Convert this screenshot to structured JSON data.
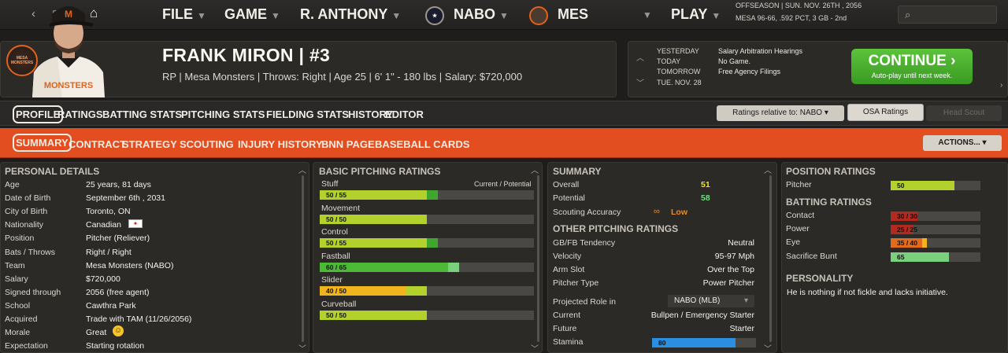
{
  "nav": {
    "back": "‹",
    "forward": "›",
    "menu": "▯",
    "home": "⌂"
  },
  "menus": {
    "file": "FILE",
    "game": "GAME",
    "manager": "R. ANTHONY",
    "league": "NABO",
    "team": "MES",
    "play": "PLAY"
  },
  "top_info": {
    "phase": "OFFSEASON",
    "date": "SUN. NOV. 26TH , 2056",
    "team": "MESA",
    "record": "96-66, .592 PCT, 3 GB - 2nd"
  },
  "search": {
    "icon": "⌕"
  },
  "player": {
    "name": "FRANK MIRON  |  #3",
    "info": "RP | Mesa Monsters  |  Throws: Right  |  Age 25  |  6' 1\" - 180 lbs  |  Salary: $720,000",
    "logo": "MESA MONSTERS"
  },
  "schedule": {
    "rows": [
      {
        "label": "YESTERDAY",
        "value": "Salary Arbitration Hearings"
      },
      {
        "label": "TODAY",
        "value": "No Game."
      },
      {
        "label": "TOMORROW",
        "value": "Free Agency Filings"
      },
      {
        "label": "TUE. NOV. 28",
        "value": ""
      }
    ],
    "continue_label": "CONTINUE  ›",
    "continue_sub": "Auto-play until next week."
  },
  "tabs1": [
    "PROFILE",
    "RATINGS",
    "BATTING STATS",
    "PITCHING STATS",
    "FIELDING STATS",
    "HISTORY",
    "EDITOR"
  ],
  "tabs1_selected": "PROFILE",
  "ratings_relative": "Ratings relative to: NABO",
  "osa_ratings": "OSA Ratings",
  "head_scout": "Head Scout",
  "tabs2": [
    "SUMMARY",
    "CONTRACT",
    "STRATEGY",
    "SCOUTING",
    "INJURY HISTORY",
    "BNN PAGE",
    "BASEBALL CARDS"
  ],
  "tabs2_selected": "SUMMARY",
  "actions": "ACTIONS...",
  "personal": {
    "title": "PERSONAL DETAILS",
    "rows": [
      {
        "label": "Age",
        "value": "25 years, 81 days"
      },
      {
        "label": "Date of Birth",
        "value": "September 6th , 2031"
      },
      {
        "label": "City of Birth",
        "value": "Toronto, ON"
      },
      {
        "label": "Nationality",
        "value": "Canadian"
      },
      {
        "label": "Position",
        "value": "Pitcher (Reliever)"
      },
      {
        "label": "Bats / Throws",
        "value": "Right / Right"
      },
      {
        "label": "Team",
        "value": "Mesa Monsters (NABO)"
      },
      {
        "label": "Salary",
        "value": "$720,000"
      },
      {
        "label": "Signed through",
        "value": "2056 (free agent)"
      },
      {
        "label": "School",
        "value": "Cawthra Park"
      },
      {
        "label": "Acquired",
        "value": "Trade with TAM (11/26/2056)"
      },
      {
        "label": "Morale",
        "value": "Great"
      },
      {
        "label": "Expectation",
        "value": "Starting rotation"
      }
    ]
  },
  "pitching": {
    "title": "BASIC PITCHING RATINGS",
    "col_header": "Current / Potential",
    "rows": [
      {
        "label": "Stuff",
        "text": "50 / 55",
        "current": 50,
        "potential": 55,
        "color": "#b3d12c",
        "pcolor": "#3fa62e"
      },
      {
        "label": "Movement",
        "text": "50 / 50",
        "current": 50,
        "potential": 50,
        "color": "#b3d12c",
        "pcolor": "#3fa62e"
      },
      {
        "label": "Control",
        "text": "50 / 55",
        "current": 50,
        "potential": 55,
        "color": "#b3d12c",
        "pcolor": "#3fa62e"
      },
      {
        "label": "Fastball",
        "text": "60 / 65",
        "current": 60,
        "potential": 65,
        "color": "#4cba36",
        "pcolor": "#7bd07d"
      },
      {
        "label": "Slider",
        "text": "40 / 50",
        "current": 40,
        "potential": 50,
        "color": "#f0b41e",
        "pcolor": "#b3d12c"
      },
      {
        "label": "Curveball",
        "text": "50 / 50",
        "current": 50,
        "potential": 50,
        "color": "#b3d12c",
        "pcolor": "#3fa62e"
      }
    ]
  },
  "summary": {
    "title": "SUMMARY",
    "overall_label": "Overall",
    "overall": "51",
    "potential_label": "Potential",
    "potential": "58",
    "accuracy_label": "Scouting Accuracy",
    "accuracy": "Low",
    "other_title": "OTHER PITCHING RATINGS",
    "other": [
      {
        "label": "GB/FB Tendency",
        "value": "Neutral"
      },
      {
        "label": "Velocity",
        "value": "95-97 Mph"
      },
      {
        "label": "Arm Slot",
        "value": "Over the Top"
      },
      {
        "label": "Pitcher Type",
        "value": "Power Pitcher"
      }
    ],
    "role_label": "Projected Role in",
    "role_select": "NABO (MLB)",
    "current_label": "Current",
    "current_value": "Bullpen / Emergency Starter",
    "future_label": "Future",
    "future_value": "Starter",
    "stamina_label": "Stamina",
    "stamina_text": "80",
    "stamina": 80
  },
  "position": {
    "title": "POSITION RATINGS",
    "pitcher_label": "Pitcher",
    "pitcher_text": "50",
    "pitcher": 50,
    "batting_title": "BATTING RATINGS",
    "batting": [
      {
        "label": "Contact",
        "text": "30 / 30",
        "current": 30,
        "potential": 30,
        "color": "#b22a1f",
        "pcolor": "#b22a1f"
      },
      {
        "label": "Power",
        "text": "25 / 25",
        "current": 25,
        "potential": 25,
        "color": "#b22a1f",
        "pcolor": "#b22a1f"
      },
      {
        "label": "Eye",
        "text": "35 / 40",
        "current": 35,
        "potential": 40,
        "color": "#e26a1c",
        "pcolor": "#f0b41e"
      },
      {
        "label": "Sacrifice Bunt",
        "text": "65",
        "current": 65,
        "potential": 65,
        "color": "#7bd07d",
        "pcolor": "#7bd07d"
      }
    ],
    "personality_title": "PERSONALITY",
    "personality": "He is nothing if not fickle and lacks initiative."
  },
  "colors": {
    "accent": "#e24e1f",
    "continue": "#4cb030",
    "overall": "#f0e22c",
    "potential": "#6fe07a",
    "low": "#f08a1c",
    "stamina": "#2a8fe0"
  }
}
